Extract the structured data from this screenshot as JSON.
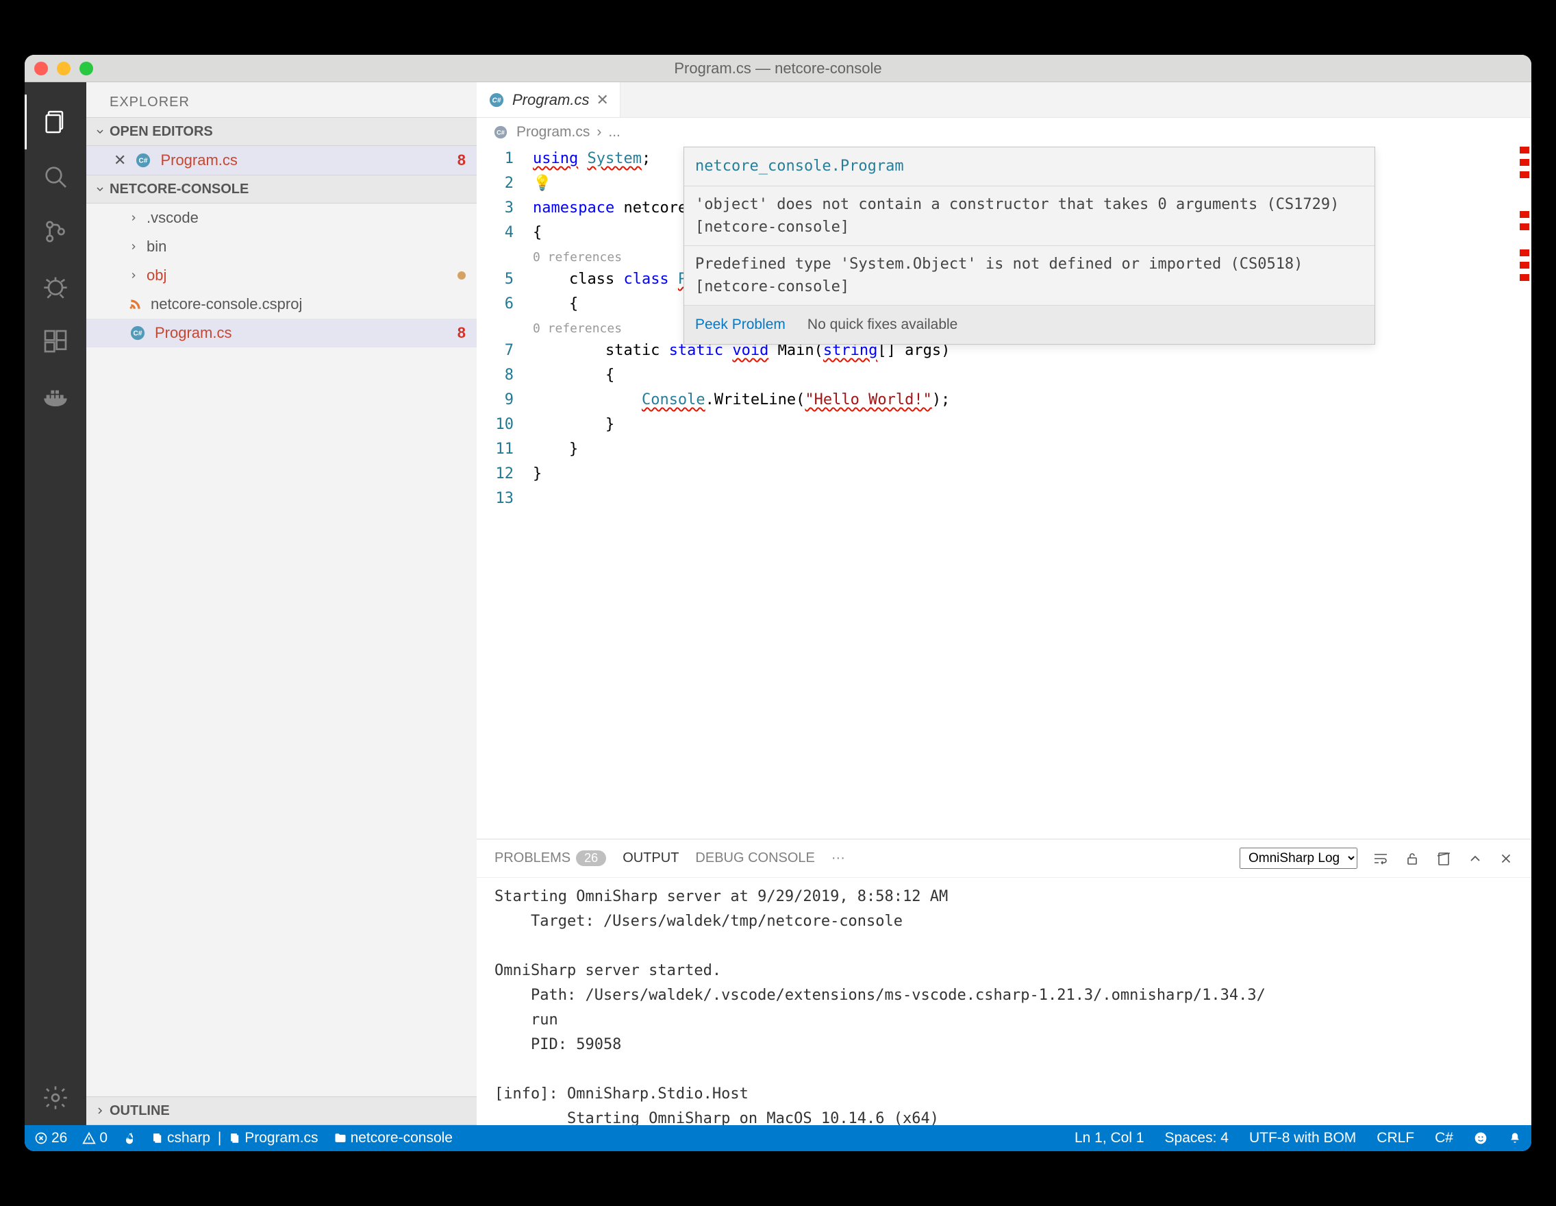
{
  "window": {
    "title": "Program.cs — netcore-console"
  },
  "sidebar": {
    "title": "EXPLORER",
    "sections": {
      "open_editors": "OPEN EDITORS",
      "folder": "NETCORE-CONSOLE",
      "outline": "OUTLINE"
    },
    "open_file": {
      "name": "Program.cs",
      "errors": "8"
    },
    "tree": {
      "vscode": ".vscode",
      "bin": "bin",
      "obj": "obj",
      "csproj": "netcore-console.csproj",
      "program": "Program.cs",
      "program_errors": "8"
    }
  },
  "tab": {
    "name": "Program.cs"
  },
  "breadcrumb": {
    "file": "Program.cs",
    "sep": "›",
    "ellipsis": "..."
  },
  "hover": {
    "header": "netcore_console.Program",
    "msg1": "'object' does not contain a constructor that takes 0 arguments (CS1729) [netcore-console]",
    "msg2": "Predefined type 'System.Object' is not defined or imported (CS0518) [netcore-console]",
    "peek": "Peek Problem",
    "nofix": "No quick fixes available"
  },
  "code": {
    "l1": "using System;",
    "l2": "",
    "l3": "namespace netcore_console",
    "l4": "{",
    "ref5": "0 references",
    "l5_a": "    class ",
    "l5_b": "Program",
    "l6": "    {",
    "ref7": "0 references",
    "l7_a": "        static ",
    "l7_void": "void",
    "l7_b": " Main(",
    "l7_str": "string",
    "l7_c": "[] args)",
    "l8": "        {",
    "l9_a": "            ",
    "l9_con": "Console",
    "l9_b": ".WriteLine(",
    "l9_str": "\"Hello World!\"",
    "l9_c": ");",
    "l10": "        }",
    "l11": "    }",
    "l12": "}",
    "l13": ""
  },
  "line_nums": [
    "1",
    "2",
    "3",
    "4",
    "5",
    "6",
    "7",
    "8",
    "9",
    "10",
    "11",
    "12",
    "13"
  ],
  "panel": {
    "problems": "PROBLEMS",
    "problems_count": "26",
    "output": "OUTPUT",
    "debug": "DEBUG CONSOLE",
    "ellipsis": "···",
    "select": "OmniSharp Log",
    "body": "Starting OmniSharp server at 9/29/2019, 8:58:12 AM\n    Target: /Users/waldek/tmp/netcore-console\n\nOmniSharp server started.\n    Path: /Users/waldek/.vscode/extensions/ms-vscode.csharp-1.21.3/.omnisharp/1.34.3/\n    run\n    PID: 59058\n\n[info]: OmniSharp.Stdio.Host\n        Starting OmniSharp on MacOS 10.14.6 (x64)"
  },
  "status": {
    "errors": "26",
    "warnings": "0",
    "csharp": "csharp",
    "program": "Program.cs",
    "folder": "netcore-console",
    "lncol": "Ln 1, Col 1",
    "spaces": "Spaces: 4",
    "encoding": "UTF-8 with BOM",
    "eol": "CRLF",
    "lang": "C#"
  }
}
